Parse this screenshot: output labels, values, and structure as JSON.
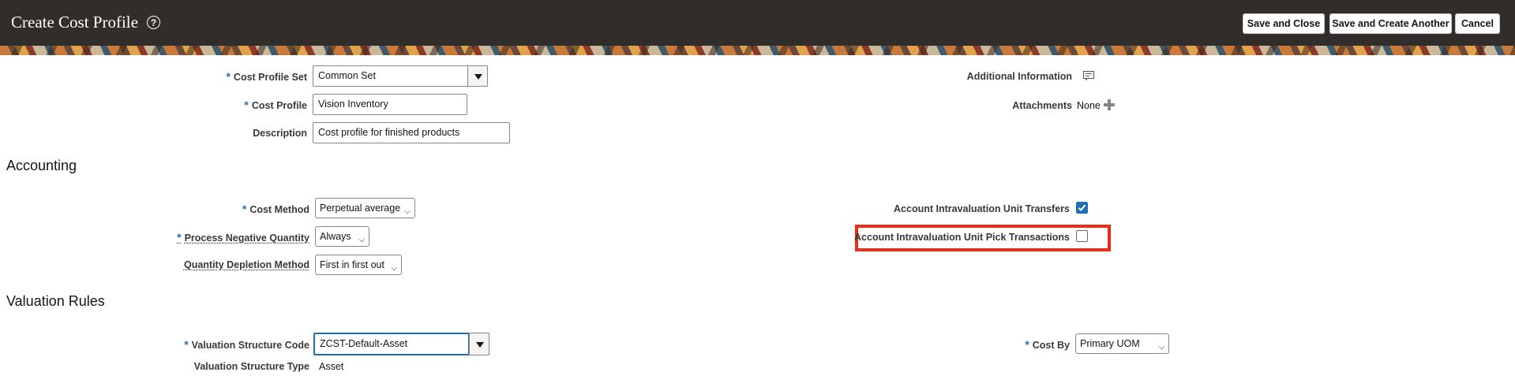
{
  "header": {
    "title": "Create Cost Profile",
    "help_icon": "help-circle-icon",
    "buttons": {
      "save_close": "Save and Close",
      "save_another": "Save and Create Another",
      "cancel": "Cancel"
    }
  },
  "profile": {
    "cost_profile_set_label": "Cost Profile Set",
    "cost_profile_set_value": "Common Set",
    "cost_profile_label": "Cost Profile",
    "cost_profile_value": "Vision Inventory",
    "description_label": "Description",
    "description_value": "Cost profile for finished products",
    "additional_info_label": "Additional Information",
    "additional_info_icon": "form-edit-icon",
    "attachments_label": "Attachments",
    "attachments_value": "None",
    "attachments_add_icon": "plus-icon"
  },
  "accounting": {
    "section_title": "Accounting",
    "cost_method_label": "Cost Method",
    "cost_method_value": "Perpetual average",
    "process_negative_label": "Process Negative Quantity",
    "process_negative_value": "Always",
    "depletion_label": "Quantity Depletion Method",
    "depletion_value": "First in first out",
    "intraval_transfers_label": "Account Intravaluation Unit Transfers",
    "intraval_transfers_checked": true,
    "intraval_pick_label": "Account Intravaluation Unit Pick Transactions",
    "intraval_pick_checked": false
  },
  "valuation": {
    "section_title": "Valuation Rules",
    "structure_code_label": "Valuation Structure Code",
    "structure_code_value": "ZCST-Default-Asset",
    "structure_type_label": "Valuation Structure Type",
    "structure_type_value": "Asset",
    "cost_by_label": "Cost By",
    "cost_by_value": "Primary UOM"
  },
  "colors": {
    "header_bg": "#312d2a",
    "required_marker": "#1f6fb4",
    "highlight_border": "#ef2b14",
    "checkbox_checked": "#1f6fb4"
  }
}
